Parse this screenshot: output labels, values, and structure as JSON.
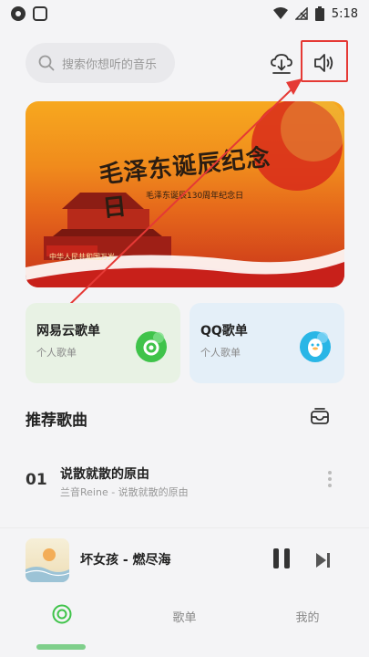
{
  "status_bar": {
    "time": "5:18"
  },
  "search": {
    "placeholder": "搜索你想听的音乐"
  },
  "banner": {
    "title": "毛泽东诞辰纪念日",
    "subtitle": "毛泽东诞辰130周年纪念日",
    "ribbon_text": "中华人民共和国万岁"
  },
  "playlists": [
    {
      "title": "网易云歌单",
      "subtitle": "个人歌单",
      "color": "#3fc34a"
    },
    {
      "title": "QQ歌单",
      "subtitle": "个人歌单",
      "color": "#29b6e6"
    }
  ],
  "recommend": {
    "title": "推荐歌曲",
    "songs": [
      {
        "index": "01",
        "name": "说散就散的原由",
        "meta": "兰音Reine - 说散就散的原由"
      }
    ]
  },
  "player": {
    "title": "坏女孩 - 燃尽海"
  },
  "nav": {
    "playlist": "歌单",
    "mine": "我的"
  },
  "colors": {
    "accent": "#3fc34a",
    "highlight": "#e53935"
  }
}
